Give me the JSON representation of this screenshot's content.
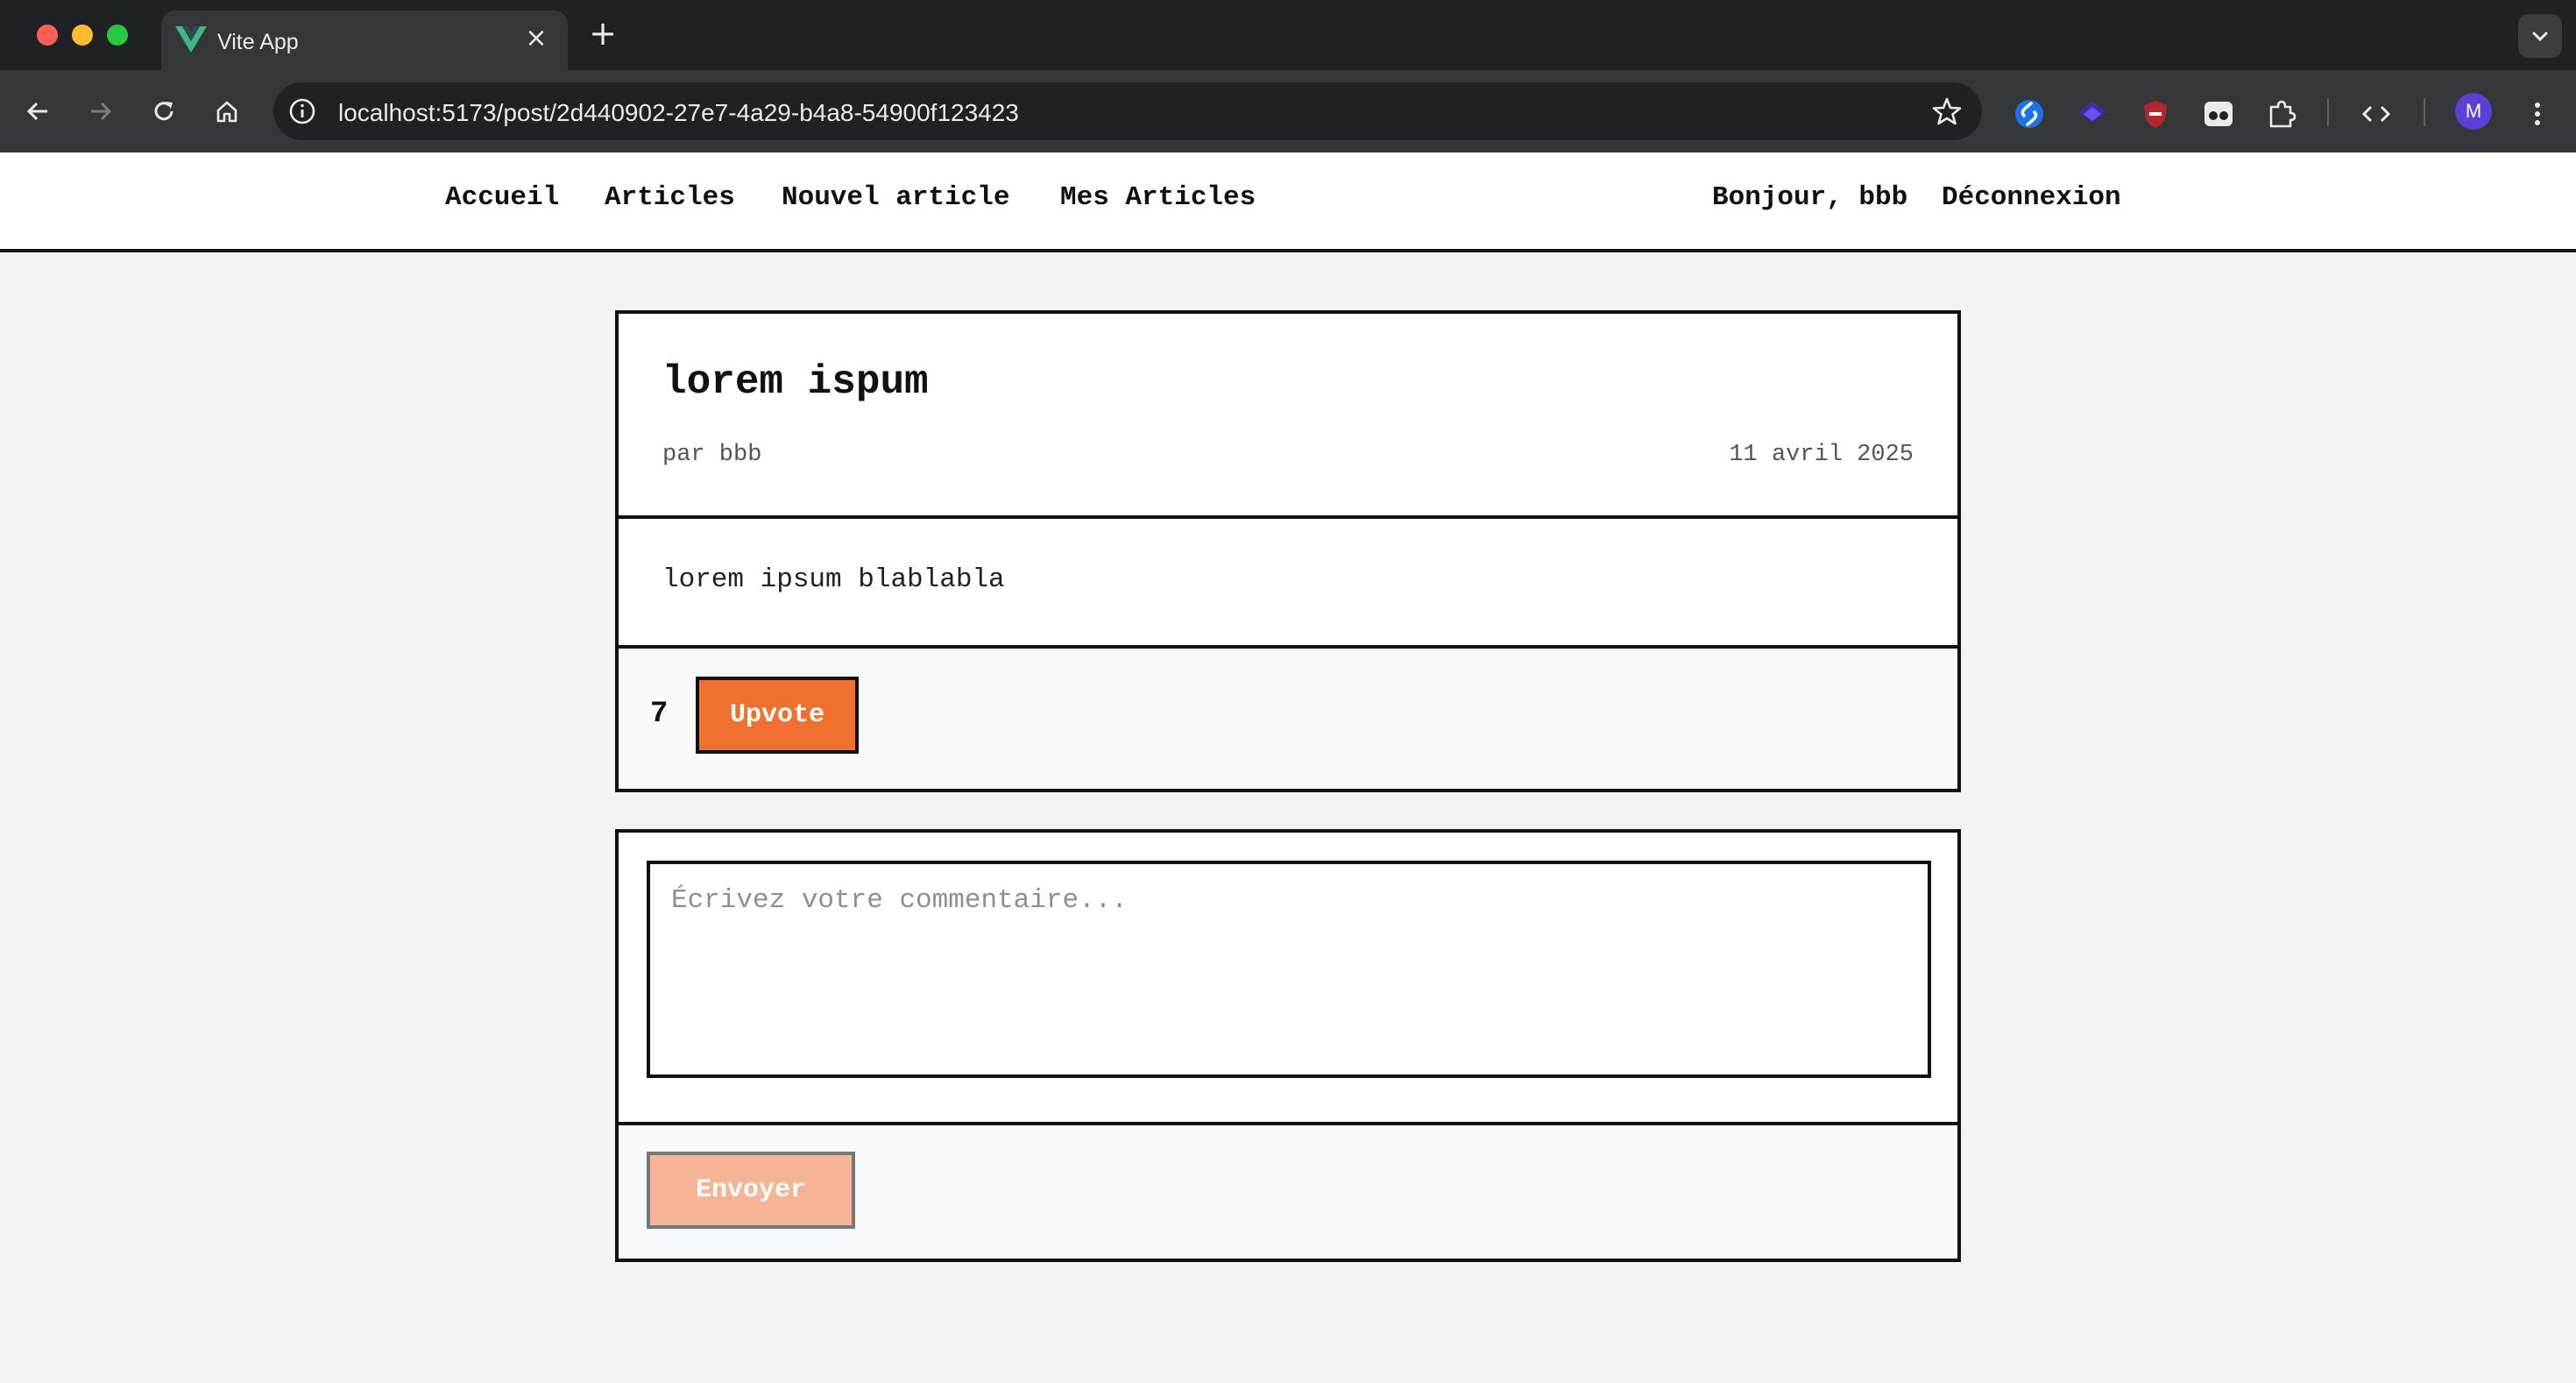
{
  "browser": {
    "tab_title": "Vite App",
    "tab_close": "×",
    "new_tab": "+",
    "url": "localhost:5173/post/2d440902-27e7-4a29-b4a8-54900f123423",
    "profile_initial": "M",
    "icons": [
      "back-arrow-icon",
      "forward-arrow-icon",
      "reload-icon",
      "home-icon",
      "site-info-icon",
      "bookmark-star-icon",
      "extensions-puzzle-icon",
      "devtools-code-icon",
      "menu-dots-icon"
    ]
  },
  "header": {
    "nav": {
      "home": "Accueil",
      "articles": "Articles",
      "new_article": "Nouvel article",
      "my_articles": "Mes Articles"
    },
    "greeting": "Bonjour, bbb",
    "logout": "Déconnexion"
  },
  "post": {
    "title": "lorem ispum",
    "author": "par bbb",
    "date": "11 avril 2025",
    "body": "lorem ipsum blablabla",
    "votes": "7",
    "upvote_label": "Upvote"
  },
  "comment_form": {
    "placeholder": "Écrivez votre commentaire...",
    "value": "",
    "submit_label": "Envoyer"
  },
  "colors": {
    "accent": "#f0702f",
    "accent_disabled": "#f4b495",
    "border": "#111111",
    "page_bg": "#f2f3f5"
  }
}
